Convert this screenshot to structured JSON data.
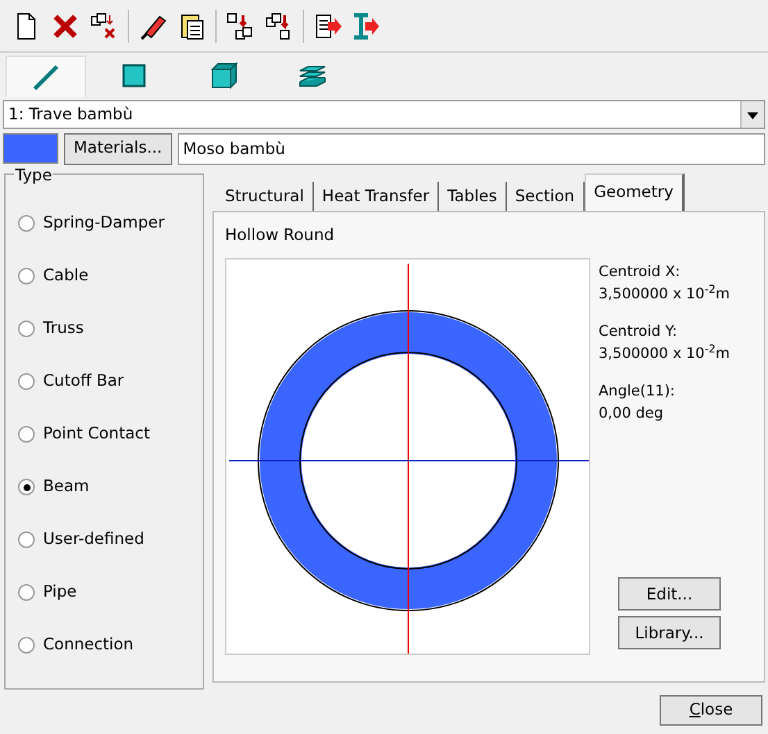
{
  "toolbar": [
    {
      "kind": "new"
    },
    {
      "kind": "delete"
    },
    {
      "kind": "copy-delete"
    },
    {
      "kind": "edit"
    },
    {
      "kind": "paste"
    },
    {
      "kind": "move"
    },
    {
      "kind": "copy"
    },
    {
      "kind": "export"
    },
    {
      "kind": "export-beam"
    }
  ],
  "shape_tabs": [
    {
      "kind": "line",
      "selected": true
    },
    {
      "kind": "square",
      "selected": false
    },
    {
      "kind": "cube",
      "selected": false
    },
    {
      "kind": "layers",
      "selected": false
    }
  ],
  "part_select": {
    "value": "1: Trave bambù"
  },
  "material": {
    "color": "#3a66ff",
    "button": "Materials...",
    "name": "Moso bambù"
  },
  "type_group": {
    "title": "Type",
    "options": [
      {
        "label": "Spring-Damper",
        "selected": false
      },
      {
        "label": "Cable",
        "selected": false
      },
      {
        "label": "Truss",
        "selected": false
      },
      {
        "label": "Cutoff Bar",
        "selected": false
      },
      {
        "label": "Point Contact",
        "selected": false
      },
      {
        "label": "Beam",
        "selected": true
      },
      {
        "label": "User-defined",
        "selected": false
      },
      {
        "label": "Pipe",
        "selected": false
      },
      {
        "label": "Connection",
        "selected": false
      }
    ]
  },
  "tabs": [
    {
      "label": "Structural",
      "selected": false
    },
    {
      "label": "Heat Transfer",
      "selected": false
    },
    {
      "label": "Tables",
      "selected": false
    },
    {
      "label": "Section",
      "selected": false
    },
    {
      "label": "Geometry",
      "selected": true
    }
  ],
  "geometry": {
    "section_name": "Hollow Round",
    "properties": [
      {
        "label": "Centroid X:",
        "value": "3,500000 x 10$^{-2}$m"
      },
      {
        "label": "Centroid Y:",
        "value": "3,500000 x 10$^{-2}$m"
      },
      {
        "label": "Angle(11):",
        "value": "0,00 deg"
      }
    ],
    "buttons": [
      "Edit...",
      "Library..."
    ]
  },
  "close_button": "Close"
}
